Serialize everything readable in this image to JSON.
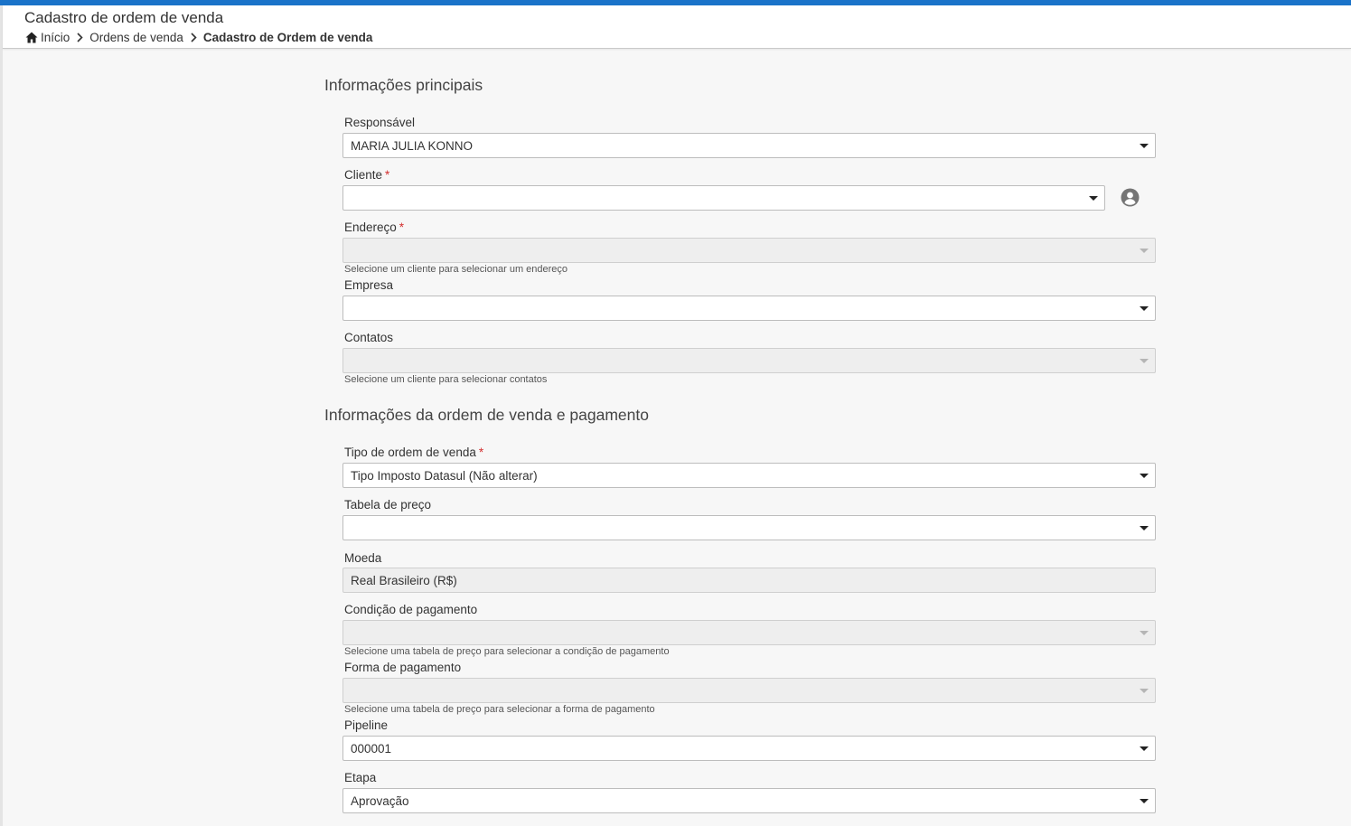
{
  "header": {
    "title": "Cadastro de ordem de venda",
    "breadcrumb": [
      "Início",
      "Ordens de venda",
      "Cadastro de Ordem de venda"
    ]
  },
  "section_main": {
    "title": "Informações principais",
    "responsavel": {
      "label": "Responsável",
      "value": "MARIA JULIA KONNO"
    },
    "cliente": {
      "label": "Cliente",
      "required": "*",
      "value": ""
    },
    "endereco": {
      "label": "Endereço",
      "required": "*",
      "value": "",
      "hint": "Selecione um cliente para selecionar um endereço"
    },
    "empresa": {
      "label": "Empresa",
      "value": ""
    },
    "contatos": {
      "label": "Contatos",
      "value": "",
      "hint": "Selecione um cliente para selecionar contatos"
    }
  },
  "section_order": {
    "title": "Informações da ordem de venda e pagamento",
    "tipo": {
      "label": "Tipo de ordem de venda",
      "required": "*",
      "value": "Tipo Imposto Datasul (Não alterar)"
    },
    "tabela": {
      "label": "Tabela de preço",
      "value": ""
    },
    "moeda": {
      "label": "Moeda",
      "value": "Real Brasileiro (R$)"
    },
    "condicao": {
      "label": "Condição de pagamento",
      "value": "",
      "hint": "Selecione uma tabela de preço para selecionar a condição de pagamento"
    },
    "forma": {
      "label": "Forma de pagamento",
      "value": "",
      "hint": "Selecione uma tabela de preço para selecionar a forma de pagamento"
    },
    "pipeline": {
      "label": "Pipeline",
      "value": "000001"
    },
    "etapa": {
      "label": "Etapa",
      "value": "Aprovação"
    }
  },
  "colors": {
    "accent": "#1a73c9",
    "required": "#d32f2f",
    "disabled_bg": "#eeeeee"
  },
  "icons": {
    "home": "home-icon",
    "breadcrumb_separator": "chevron-right-icon",
    "dropdown": "caret-down-icon",
    "client": "user-circle-icon"
  }
}
